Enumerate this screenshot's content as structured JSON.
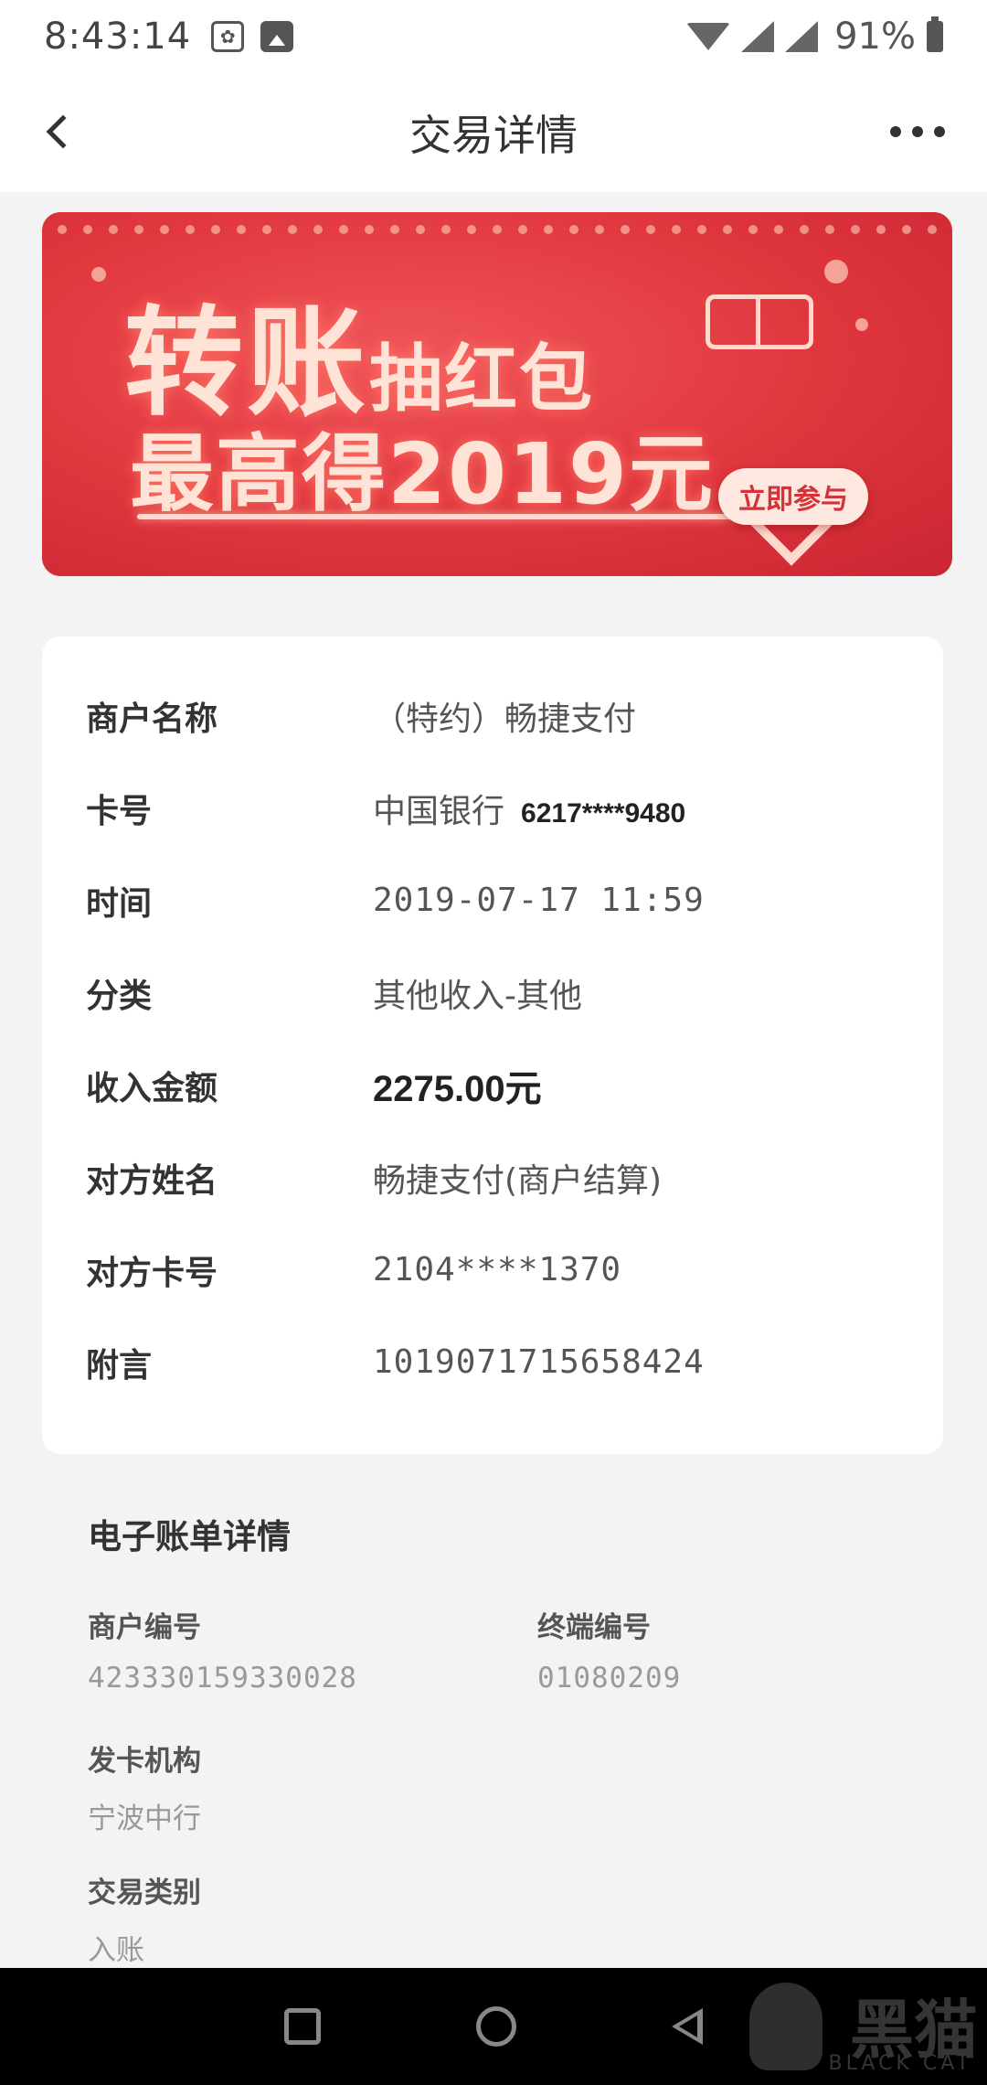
{
  "status_bar": {
    "time": "8:43:14",
    "battery": "91%",
    "icons": [
      "baidu-icon",
      "image-icon",
      "wifi-icon",
      "signal-icon",
      "signal-icon",
      "battery-icon"
    ]
  },
  "header": {
    "title": "交易详情",
    "back_icon": "chevron-left-icon",
    "more_icon": "more-horizontal-icon"
  },
  "banner": {
    "line1_big": "转账",
    "line1_small": "抽红包",
    "line2": "最高得2019元",
    "cta": "立即参与",
    "colors": {
      "bg": "#e0363e",
      "text": "#ffe3d6",
      "cta_text": "#d5323a"
    }
  },
  "details": {
    "merchant_name": {
      "label": "商户名称",
      "value": "（特约）畅捷支付"
    },
    "card_number": {
      "label": "卡号",
      "bank": "中国银行",
      "number": "6217****9480"
    },
    "time": {
      "label": "时间",
      "value": "2019-07-17 11:59"
    },
    "category": {
      "label": "分类",
      "value": "其他收入-其他"
    },
    "income_amount": {
      "label": "收入金额",
      "value": "2275.00元"
    },
    "counterparty_name": {
      "label": "对方姓名",
      "value": "畅捷支付(商户结算)"
    },
    "counterparty_card": {
      "label": "对方卡号",
      "value": "2104****1370"
    },
    "remark": {
      "label": "附言",
      "value": "1019071715658424"
    }
  },
  "bill": {
    "title": "电子账单详情",
    "merchant_no": {
      "label": "商户编号",
      "value": "423330159330028"
    },
    "terminal_no": {
      "label": "终端编号",
      "value": "01080209"
    },
    "issuer": {
      "label": "发卡机构",
      "value": "宁波中行"
    },
    "txn_type": {
      "label": "交易类别",
      "value": "入账"
    }
  },
  "watermark": {
    "zh": "黑猫",
    "en": "BLACK CAT"
  }
}
